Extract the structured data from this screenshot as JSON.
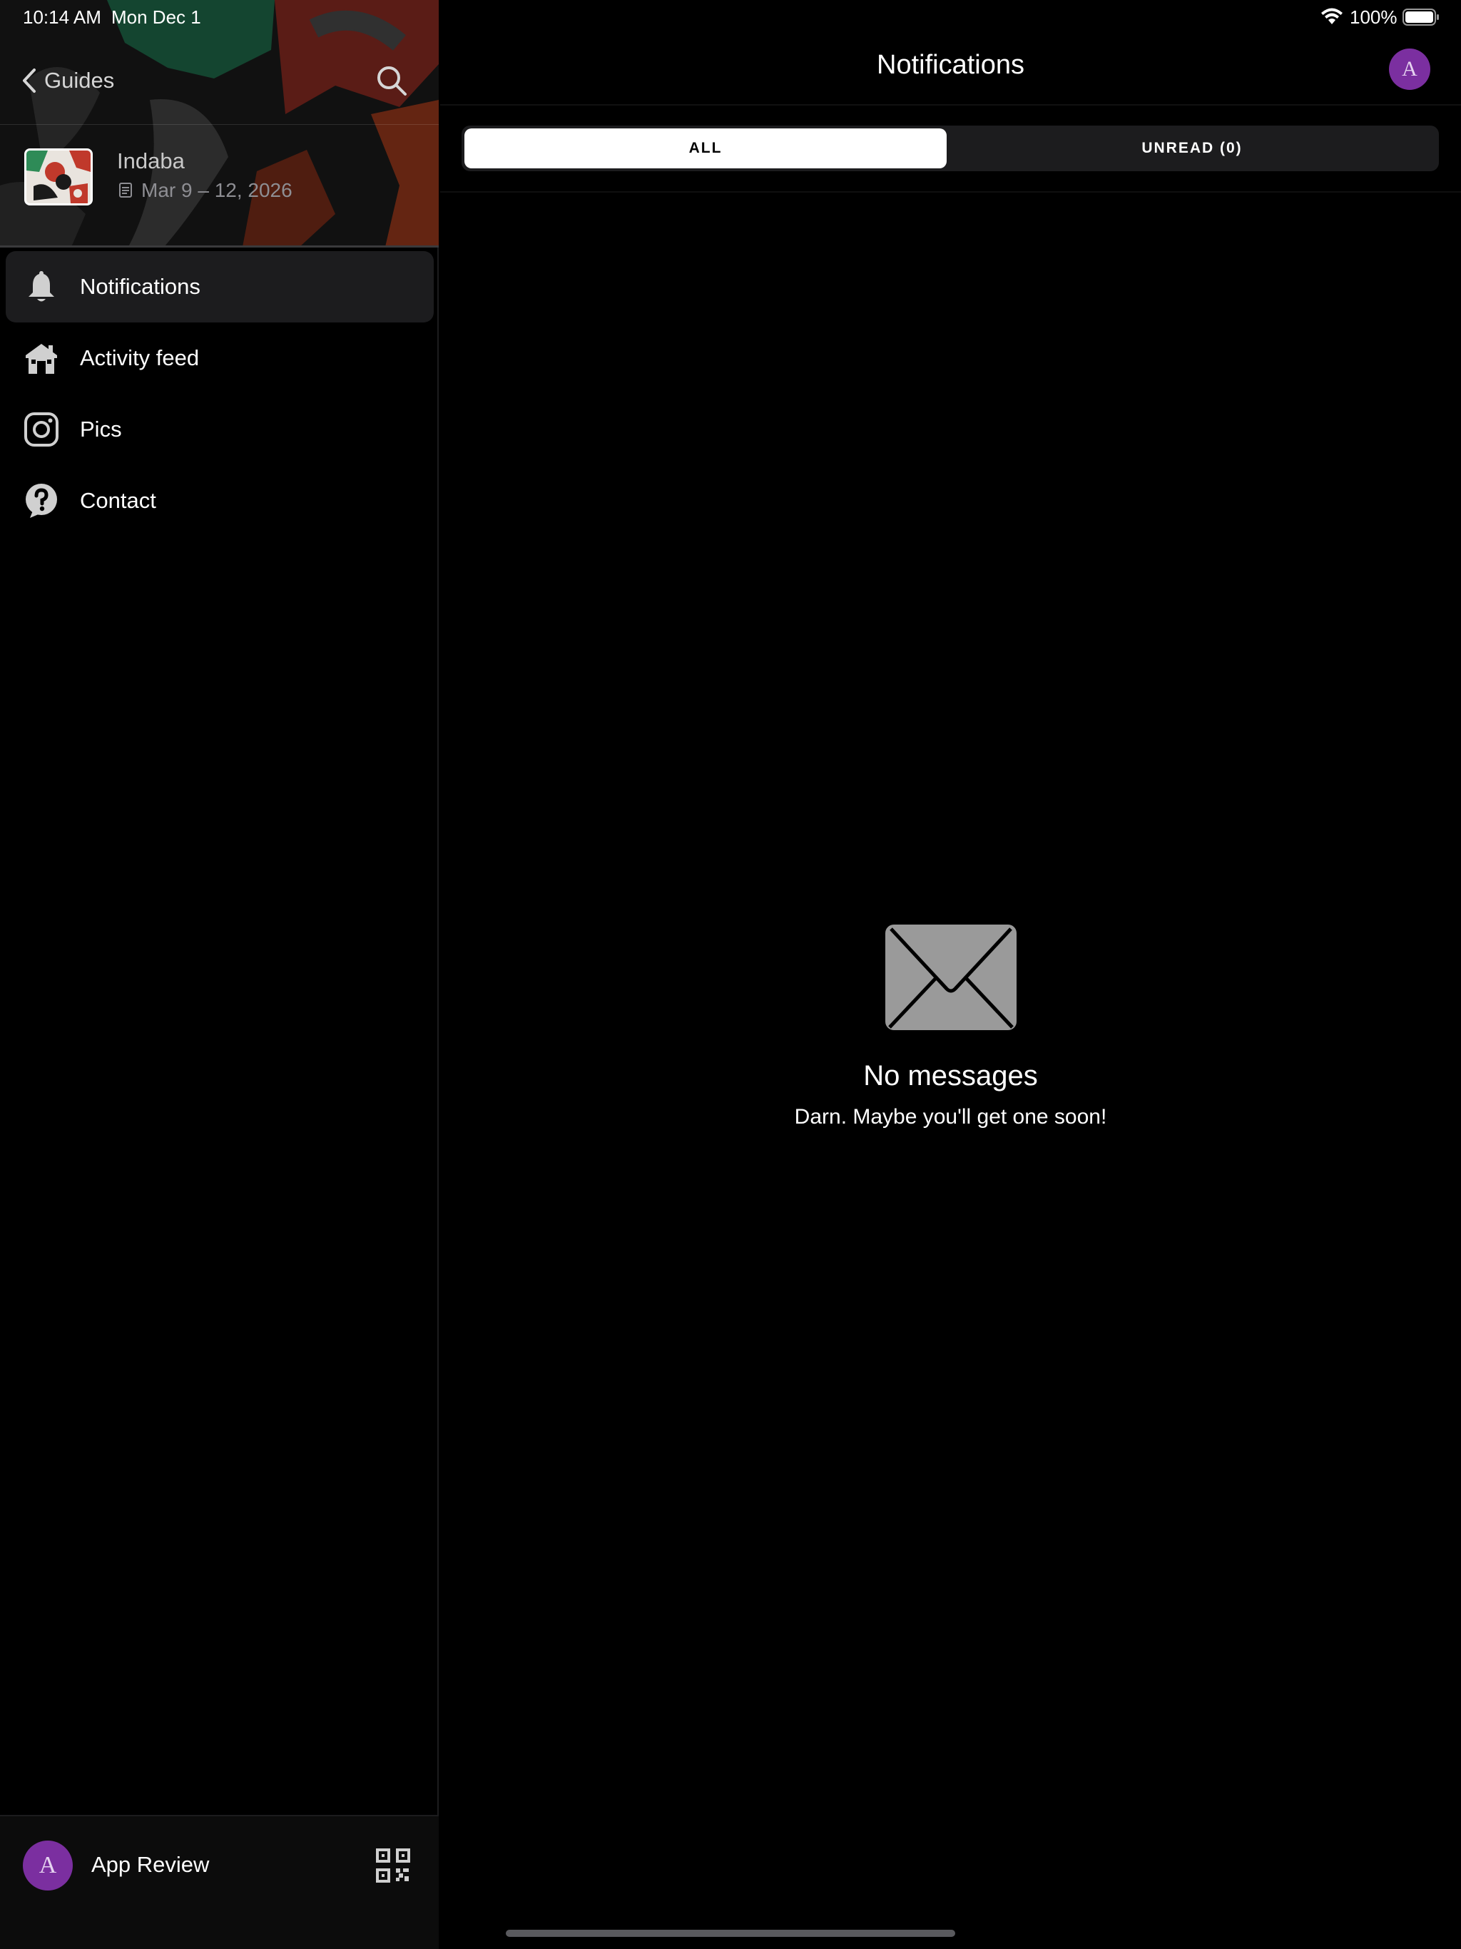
{
  "status_bar": {
    "time": "10:14 AM",
    "date": "Mon Dec 1",
    "battery_percent": "100%"
  },
  "sidebar": {
    "back_label": "Guides",
    "event": {
      "title": "Indaba",
      "dates": "Mar 9 – 12, 2026"
    },
    "nav_items": [
      {
        "label": "Notifications",
        "icon": "bell-icon",
        "active": true
      },
      {
        "label": "Activity feed",
        "icon": "building-icon",
        "active": false
      },
      {
        "label": "Pics",
        "icon": "instagram-icon",
        "active": false
      },
      {
        "label": "Contact",
        "icon": "help-icon",
        "active": false
      }
    ],
    "footer": {
      "avatar_letter": "A",
      "user_name": "App Review"
    }
  },
  "main": {
    "title": "Notifications",
    "avatar_letter": "A",
    "tabs": [
      {
        "label": "ALL",
        "selected": true
      },
      {
        "label": "UNREAD (0)",
        "selected": false
      }
    ],
    "empty_state": {
      "icon": "envelope-icon",
      "title": "No messages",
      "subtitle": "Darn. Maybe you'll get one soon!"
    }
  },
  "colors": {
    "background": "#000000",
    "sidebar_active": "#1c1c1e",
    "avatar_purple": "#7b2fa0",
    "envelope_gray": "#9a9a9a"
  }
}
